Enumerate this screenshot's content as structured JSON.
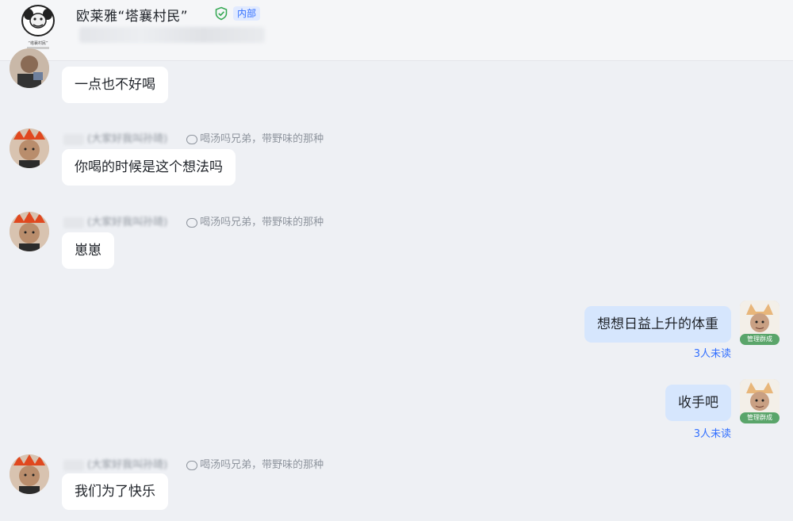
{
  "header": {
    "group_name": "欧莱雅“塔襄村民”",
    "badge": "内部",
    "group_avatar_caption": "“塔襄村民”"
  },
  "messages": [
    {
      "direction": "in",
      "text": "一点也不好喝"
    },
    {
      "direction": "in",
      "sender_name": "(大家好我叫孙琦)",
      "signature": "喝汤吗兄弟，带野味的那种",
      "text": "你喝的时候是这个想法吗"
    },
    {
      "direction": "in",
      "sender_name": "(大家好我叫孙琦)",
      "signature": "喝汤吗兄弟，带野味的那种",
      "text": "崽崽"
    },
    {
      "direction": "out",
      "text": "想想日益上升的体重",
      "read_status": "3人未读",
      "sender_tag": "管理群成"
    },
    {
      "direction": "out",
      "text": "收手吧",
      "read_status": "3人未读",
      "sender_tag": "管理群成"
    },
    {
      "direction": "in",
      "sender_name": "(大家好我叫孙琦)",
      "signature": "喝汤吗兄弟，带野味的那种",
      "text": "我们为了快乐"
    }
  ],
  "colors": {
    "background": "#eef0f4",
    "incoming_bubble": "#ffffff",
    "outgoing_bubble": "#d6e6fd",
    "accent_blue": "#3370ff",
    "admin_tag_green": "#5aa56a"
  },
  "icons": [
    "group-meme-avatar-icon",
    "verified-shield-icon",
    "signature-bubble-icon"
  ]
}
